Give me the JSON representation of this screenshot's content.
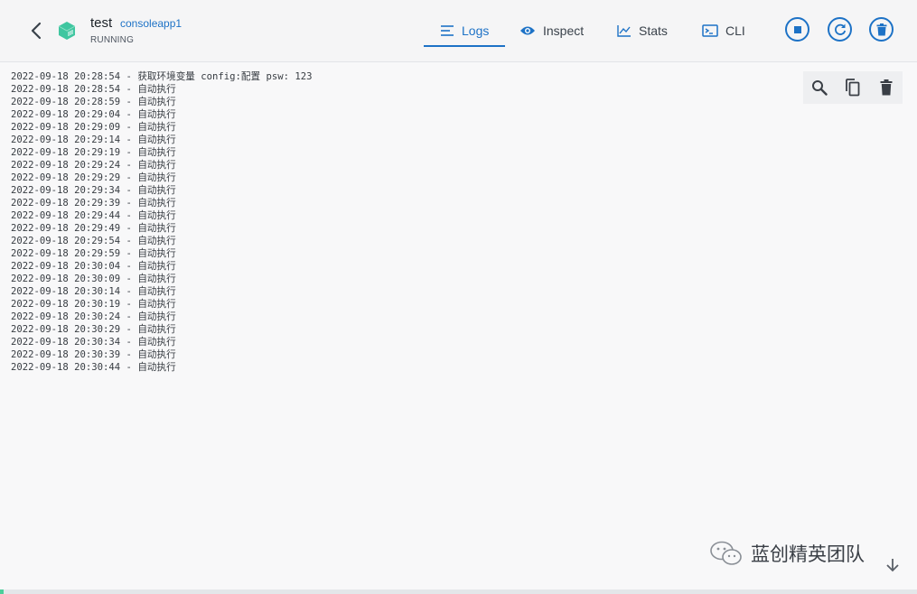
{
  "header": {
    "container_name": "test",
    "image_name": "consoleapp1",
    "status": "RUNNING",
    "icons": {
      "back": "chevron-left-icon",
      "container": "container-cube-icon"
    }
  },
  "tabs": [
    {
      "label": "Logs",
      "icon": "logs-lines-icon",
      "active": true
    },
    {
      "label": "Inspect",
      "icon": "eye-icon",
      "active": false
    },
    {
      "label": "Stats",
      "icon": "line-chart-icon",
      "active": false
    },
    {
      "label": "CLI",
      "icon": "terminal-icon",
      "active": false
    }
  ],
  "actions": [
    {
      "name": "stop",
      "icon": "stop-icon"
    },
    {
      "name": "restart",
      "icon": "restart-icon"
    },
    {
      "name": "delete",
      "icon": "trash-icon"
    }
  ],
  "log_toolbar": {
    "icons": [
      "search-icon",
      "copy-icon",
      "trash-icon"
    ]
  },
  "logs": [
    "2022-09-18 20:28:54 - 获取环境变量 config:配置 psw: 123",
    "2022-09-18 20:28:54 - 自动执行",
    "2022-09-18 20:28:59 - 自动执行",
    "2022-09-18 20:29:04 - 自动执行",
    "2022-09-18 20:29:09 - 自动执行",
    "2022-09-18 20:29:14 - 自动执行",
    "2022-09-18 20:29:19 - 自动执行",
    "2022-09-18 20:29:24 - 自动执行",
    "2022-09-18 20:29:29 - 自动执行",
    "2022-09-18 20:29:34 - 自动执行",
    "2022-09-18 20:29:39 - 自动执行",
    "2022-09-18 20:29:44 - 自动执行",
    "2022-09-18 20:29:49 - 自动执行",
    "2022-09-18 20:29:54 - 自动执行",
    "2022-09-18 20:29:59 - 自动执行",
    "2022-09-18 20:30:04 - 自动执行",
    "2022-09-18 20:30:09 - 自动执行",
    "2022-09-18 20:30:14 - 自动执行",
    "2022-09-18 20:30:19 - 自动执行",
    "2022-09-18 20:30:24 - 自动执行",
    "2022-09-18 20:30:29 - 自动执行",
    "2022-09-18 20:30:34 - 自动执行",
    "2022-09-18 20:30:39 - 自动执行",
    "2022-09-18 20:30:44 - 自动执行"
  ],
  "watermark": {
    "text": "蓝创精英团队",
    "icon": "wechat-icon"
  },
  "scroll_icon": "arrow-down-icon",
  "colors": {
    "accent": "#1d72c6",
    "container_icon": "#3fc6a0",
    "running_accent": "#4ccf9a"
  }
}
